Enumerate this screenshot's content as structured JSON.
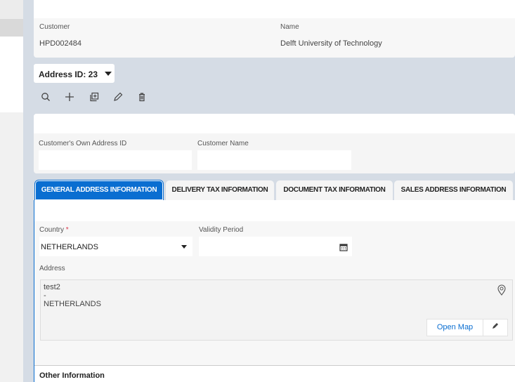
{
  "header": {
    "customer_label": "Customer",
    "customer_value": "HPD002484",
    "name_label": "Name",
    "name_value": "Delft University of Technology"
  },
  "address_selector": {
    "label": "Address ID: 23"
  },
  "toolbar": {
    "icons": [
      "search-icon",
      "plus-icon",
      "duplicate-icon",
      "edit-icon",
      "delete-icon"
    ]
  },
  "filters": {
    "own_id_label": "Customer's Own Address ID",
    "own_id_value": "",
    "customer_name_label": "Customer Name",
    "customer_name_value": ""
  },
  "tabs": [
    {
      "label": "GENERAL ADDRESS INFORMATION",
      "active": true
    },
    {
      "label": "DELIVERY TAX INFORMATION"
    },
    {
      "label": "DOCUMENT TAX INFORMATION"
    },
    {
      "label": "SALES ADDRESS INFORMATION"
    }
  ],
  "general": {
    "country_label": "Country",
    "required_mark": "*",
    "country_value": "NETHERLANDS",
    "validity_label": "Validity Period",
    "validity_value": "",
    "address_label": "Address",
    "address_lines": [
      "test2",
      "-",
      "NETHERLANDS"
    ],
    "open_map": "Open Map"
  },
  "other_info": {
    "title": "Other Information"
  },
  "colors": {
    "accent": "#0a6ed1",
    "required": "#d9364a"
  }
}
